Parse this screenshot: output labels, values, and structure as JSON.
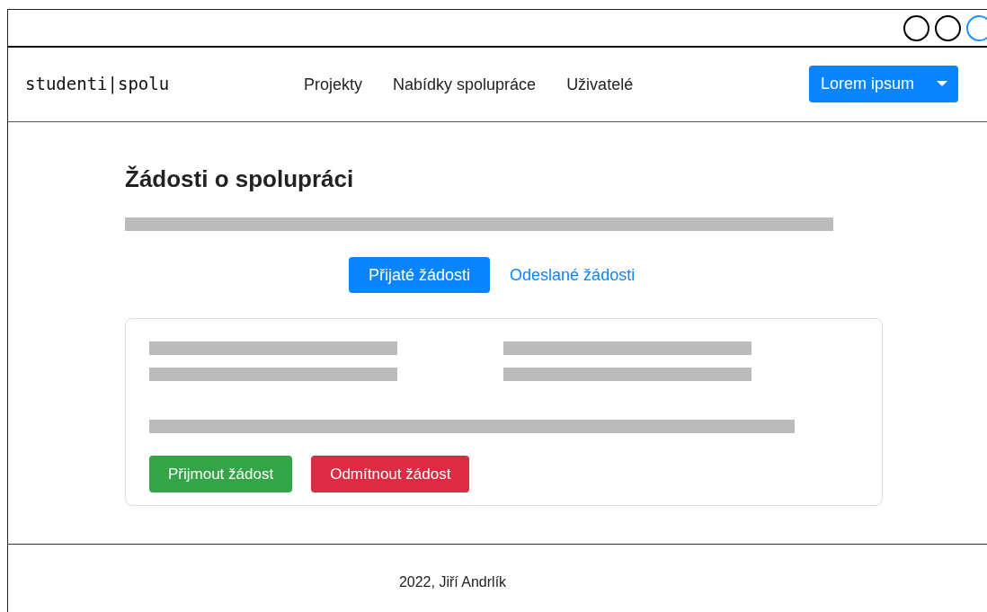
{
  "window": {
    "controls": [
      {
        "color": "#000000"
      },
      {
        "color": "#000000"
      },
      {
        "color": "#1e90ff"
      }
    ]
  },
  "navbar": {
    "logo": "studenti|spolu",
    "links": [
      "Projekty",
      "Nabídky spolupráce",
      "Uživatelé"
    ],
    "user_menu": "Lorem ipsum"
  },
  "page": {
    "title": "Žádosti o spolupráci",
    "tabs": [
      {
        "label": "Přijaté žádosti",
        "selected": true
      },
      {
        "label": "Odeslané žádosti",
        "selected": false
      }
    ],
    "request_card": {
      "actions": [
        {
          "label": "Přijmout žádost",
          "kind": "accept"
        },
        {
          "label": "Odmítnout žádost",
          "kind": "reject"
        }
      ]
    }
  },
  "footer": {
    "text": "2022, Jiří Andrlík"
  }
}
